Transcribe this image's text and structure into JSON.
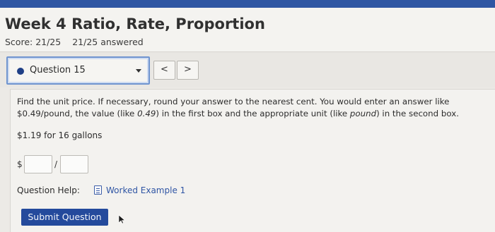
{
  "header": {
    "title": "Week 4 Ratio, Rate, Proportion",
    "score": "Score: 21/25",
    "answered": "21/25 answered"
  },
  "nav": {
    "question_label": "Question 15",
    "prev_label": "<",
    "next_label": ">"
  },
  "question": {
    "prompt_line1": "Find the unit price. If necessary, round your answer to the nearest cent. You would enter an answer like",
    "prompt_line2_a": "$0.49/pound, the value (like ",
    "prompt_line2_em1": "0.49",
    "prompt_line2_b": ") in the first box and the appropriate unit (like ",
    "prompt_line2_em2": "pound",
    "prompt_line2_c": ") in the second box.",
    "problem": "$1.19 for 16 gallons",
    "dollar_sign": "$",
    "slash": "/",
    "price_value": "",
    "unit_value": ""
  },
  "help": {
    "label": "Question Help:",
    "link": "Worked Example 1"
  },
  "actions": {
    "submit_label": "Submit Question"
  },
  "colors": {
    "topbar": "#2f56a3",
    "select_border": "#6f94cf",
    "submit_bg": "#244a9c",
    "link": "#2f55a4",
    "dot": "#1f3f86"
  }
}
